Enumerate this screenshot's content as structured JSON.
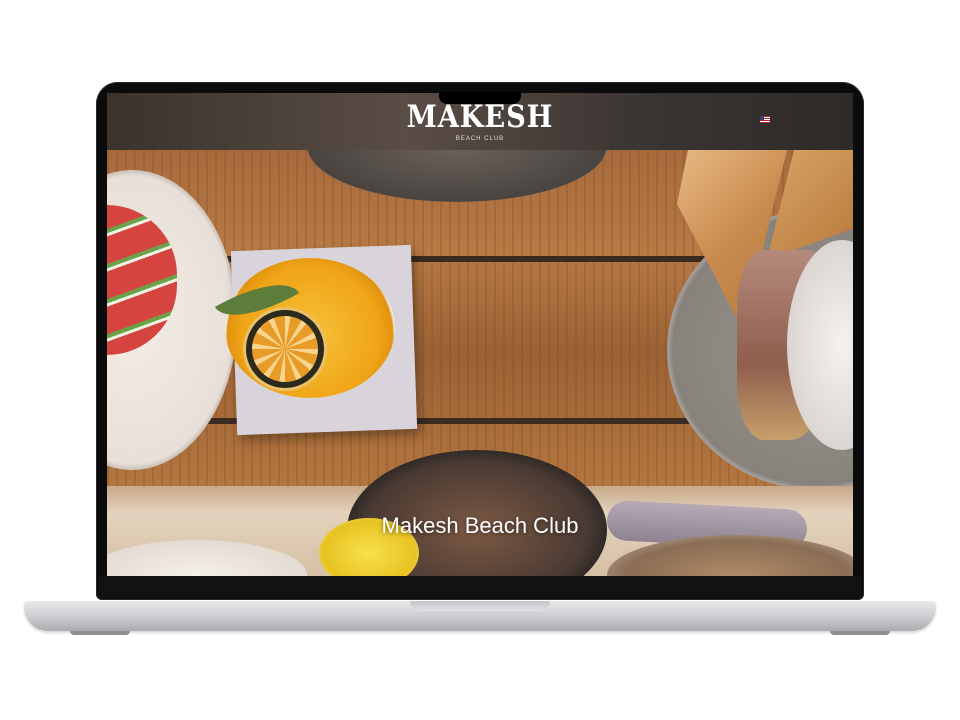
{
  "site": {
    "logo": "MAKESH",
    "tagline": "BEACH CLUB",
    "language_flag": "us-flag-icon"
  },
  "hero": {
    "title": "Makesh Beach Club"
  },
  "colors": {
    "header_bg": "#4a3f38",
    "text": "#ffffff",
    "laptop_frame": "#0b0b0c",
    "laptop_base": "#d6d7d9"
  }
}
